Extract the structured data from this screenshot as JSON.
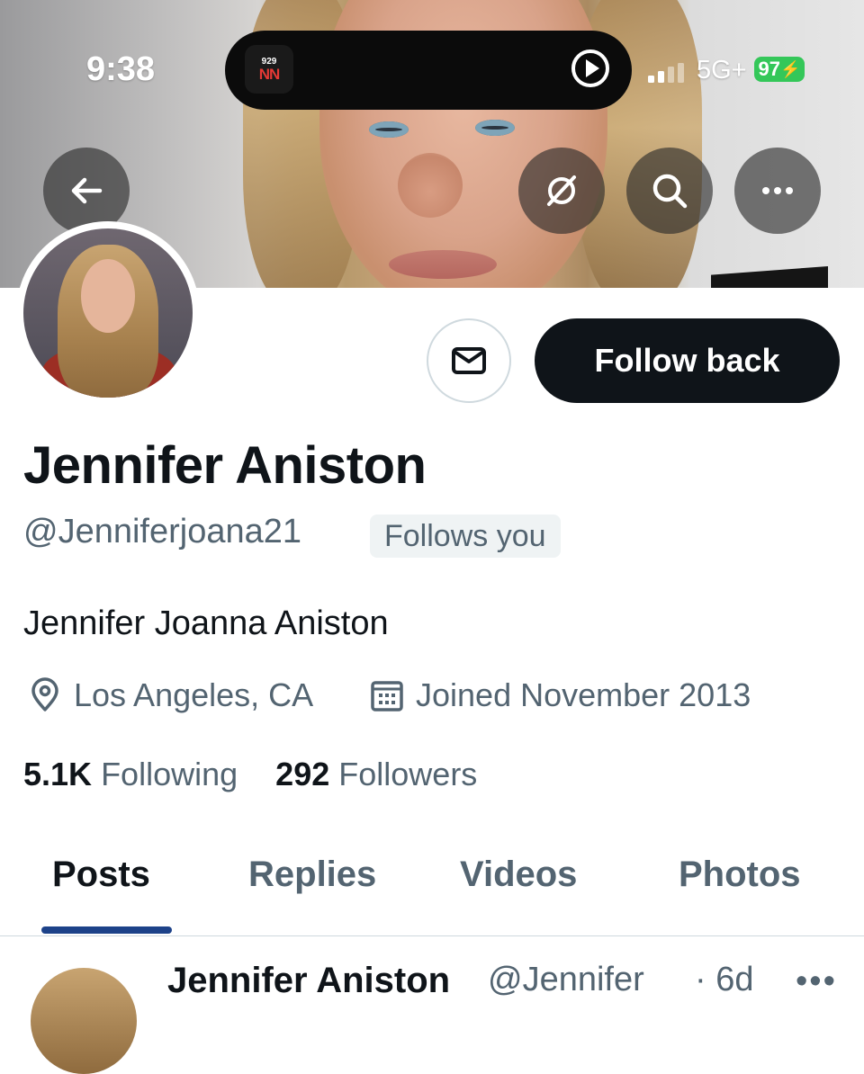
{
  "status_bar": {
    "time": "9:38",
    "live_activity_app": {
      "line1": "929",
      "line2": "NN"
    },
    "network": "5G+",
    "battery": "97"
  },
  "header_icons": {
    "back": "arrow-left-icon",
    "grok": "grok-icon",
    "search": "search-icon",
    "more": "more-icon"
  },
  "profile": {
    "display_name": "Jennifer Aniston",
    "handle": "@Jenniferjoana21",
    "follows_you_badge": "Follows you",
    "bio": "Jennifer Joanna Aniston",
    "location": "Los Angeles, CA",
    "joined": "Joined November 2013",
    "following_count": "5.1K",
    "following_label": "Following",
    "followers_count": "292",
    "followers_label": "Followers"
  },
  "actions": {
    "follow_back_label": "Follow back",
    "message_icon": "envelope-icon"
  },
  "tabs": [
    {
      "label": "Posts",
      "active": true
    },
    {
      "label": "Replies",
      "active": false
    },
    {
      "label": "Videos",
      "active": false
    },
    {
      "label": "Photos",
      "active": false
    }
  ],
  "first_post": {
    "author": "Jennifer Aniston",
    "handle": "@Jennifer",
    "time": "· 6d",
    "more": "•••"
  },
  "colors": {
    "primary_text": "#0f1419",
    "secondary_text": "#536471",
    "tab_indicator": "#1d4289",
    "battery": "#34c759"
  }
}
